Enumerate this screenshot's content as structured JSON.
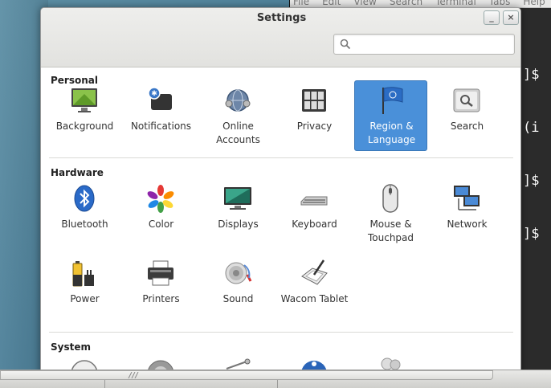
{
  "terminal": {
    "menu": [
      "File",
      "Edit",
      "View",
      "Search",
      "Terminal",
      "Tabs",
      "Help"
    ],
    "lines": [
      "]$",
      "(i",
      "]$",
      "]$"
    ]
  },
  "window": {
    "title": "Settings",
    "minimize_label": "_",
    "close_label": "×",
    "search_placeholder": ""
  },
  "sections": {
    "personal": {
      "title": "Personal",
      "items": [
        {
          "label": "Background",
          "icon": "background-icon"
        },
        {
          "label": "Notifications",
          "icon": "notifications-icon"
        },
        {
          "label": "Online Accounts",
          "icon": "online-accounts-icon"
        },
        {
          "label": "Privacy",
          "icon": "privacy-icon"
        },
        {
          "label": "Region & Language",
          "icon": "region-language-icon",
          "selected": true
        },
        {
          "label": "Search",
          "icon": "search-icon"
        }
      ]
    },
    "hardware": {
      "title": "Hardware",
      "items": [
        {
          "label": "Bluetooth",
          "icon": "bluetooth-icon"
        },
        {
          "label": "Color",
          "icon": "color-icon"
        },
        {
          "label": "Displays",
          "icon": "displays-icon"
        },
        {
          "label": "Keyboard",
          "icon": "keyboard-icon"
        },
        {
          "label": "Mouse & Touchpad",
          "icon": "mouse-icon"
        },
        {
          "label": "Network",
          "icon": "network-icon"
        },
        {
          "label": "Power",
          "icon": "power-icon"
        },
        {
          "label": "Printers",
          "icon": "printer-icon"
        },
        {
          "label": "Sound",
          "icon": "sound-icon"
        },
        {
          "label": "Wacom Tablet",
          "icon": "wacom-tablet-icon"
        }
      ]
    },
    "system": {
      "title": "System"
    }
  },
  "colors": {
    "selected": "#4a90d9",
    "terminal_bg": "#2b2b2b"
  }
}
